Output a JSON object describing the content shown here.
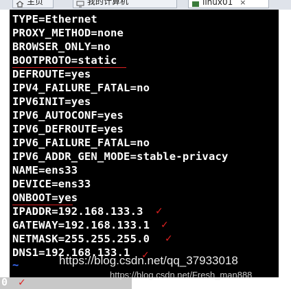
{
  "tabs": [
    {
      "label": "主页",
      "icon": "home-icon"
    },
    {
      "label": "我的计算机",
      "icon": "computer-icon"
    },
    {
      "label": "linux01",
      "icon": "vm-icon",
      "close": "×"
    }
  ],
  "terminal": {
    "lines": [
      "TYPE=Ethernet",
      "PROXY_METHOD=none",
      "BROWSER_ONLY=no",
      "BOOTPROTO=static",
      "DEFROUTE=yes",
      "IPV4_FAILURE_FATAL=no",
      "IPV6INIT=yes",
      "IPV6_AUTOCONF=yes",
      "IPV6_DEFROUTE=yes",
      "IPV6_FAILURE_FATAL=no",
      "IPV6_ADDR_GEN_MODE=stable-privacy",
      "NAME=ens33",
      "DEVICE=ens33",
      "ONBOOT=yes",
      "IPADDR=192.168.133.3",
      "GATEWAY=192.168.133.1",
      "NETMASK=255.255.255.0",
      "DNS1=192.168.133.1"
    ],
    "tilde": "~",
    "status": "0"
  },
  "annotations": {
    "check_glyph": "✓",
    "underline_color": "#e02020"
  },
  "watermark": {
    "main": "https://blog.csdn.net/qq_37933018",
    "secondary": "https://blog.csdn.net/Fresh_man888"
  },
  "colors": {
    "terminal_bg": "#000000",
    "terminal_fg": "#ffffff",
    "tilde": "#3c6eff",
    "annotation": "#e02020"
  }
}
